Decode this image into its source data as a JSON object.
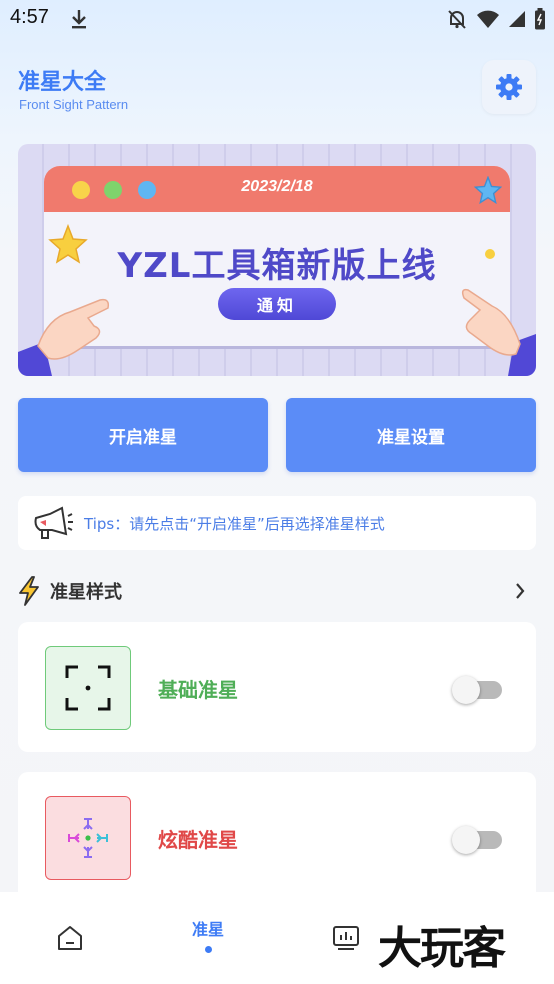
{
  "status_bar": {
    "time": "4:57",
    "icons": [
      "download-icon",
      "notifications-off-icon",
      "wifi-icon",
      "signal-icon",
      "battery-icon"
    ]
  },
  "header": {
    "title": "准星大全",
    "subtitle": "Front Sight Pattern",
    "settings_icon": "gear-icon"
  },
  "banner": {
    "date": "2023/2/18",
    "headline": "YZL工具箱新版上线",
    "pill": "通知"
  },
  "actions": {
    "enable_label": "开启准星",
    "settings_label": "准星设置"
  },
  "tips": {
    "text": "Tips：请先点击“开启准星”后再选择准星样式"
  },
  "section": {
    "title": "准星样式",
    "icon": "lightning-icon"
  },
  "styles": [
    {
      "label": "基础准星",
      "enabled": false,
      "accent": "#4fae57"
    },
    {
      "label": "炫酷准星",
      "enabled": false,
      "accent": "#e04848"
    }
  ],
  "bottom_nav": {
    "items": [
      {
        "label": "",
        "icon": "home-icon",
        "active": false
      },
      {
        "label": "准星",
        "icon": "",
        "active": true
      },
      {
        "label": "",
        "icon": "stats-icon",
        "active": false
      }
    ]
  },
  "watermark": "大玩客",
  "colors": {
    "primary": "#5b8cf7",
    "title_blue": "#3d7bf5",
    "banner_red": "#f07a6d",
    "banner_purple": "#4f49c8"
  }
}
